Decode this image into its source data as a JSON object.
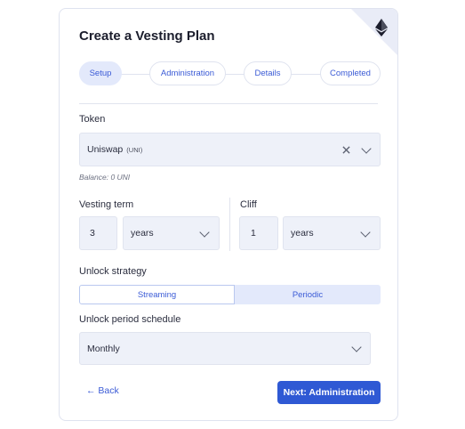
{
  "title": "Create a Vesting Plan",
  "steps": [
    {
      "label": "Setup",
      "active": true
    },
    {
      "label": "Administration",
      "active": false
    },
    {
      "label": "Details",
      "active": false
    },
    {
      "label": "Completed",
      "active": false
    }
  ],
  "token": {
    "label": "Token",
    "name": "Uniswap",
    "symbol": "(UNI)",
    "clear_icon": "close-icon",
    "dropdown_icon": "chevron-down-icon",
    "balance": "Balance: 0 UNI"
  },
  "vesting_term": {
    "label": "Vesting term",
    "value": "3",
    "unit": "years"
  },
  "cliff": {
    "label": "Cliff",
    "value": "1",
    "unit": "years"
  },
  "unlock_strategy": {
    "label": "Unlock strategy",
    "options": [
      "Streaming",
      "Periodic"
    ],
    "selected": "Periodic"
  },
  "unlock_schedule": {
    "label": "Unlock period schedule",
    "value": "Monthly"
  },
  "footer": {
    "back_label": "← Back",
    "next_label": "Next: Administration"
  },
  "colors": {
    "accent": "#2f59d4",
    "field_bg": "#eef1f9",
    "active_step": "#e3e9fb"
  }
}
